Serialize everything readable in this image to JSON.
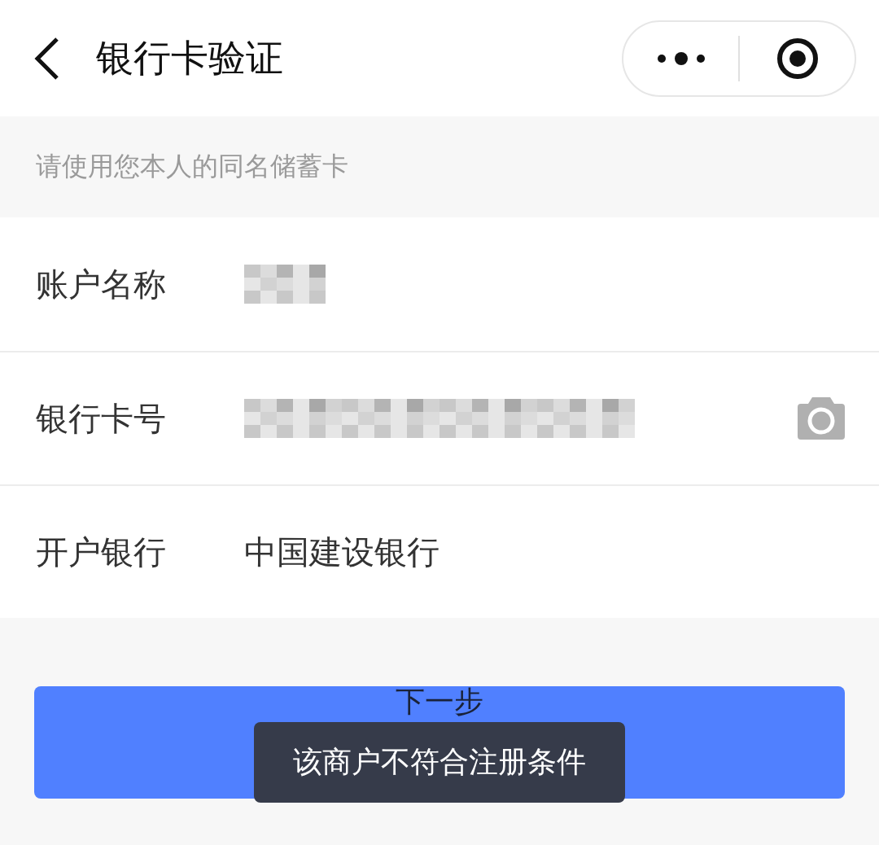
{
  "header": {
    "title": "银行卡验证"
  },
  "hint": "请使用您本人的同名储蓄卡",
  "fields": [
    {
      "kind": "masked",
      "label": "账户名称"
    },
    {
      "kind": "masked_camera",
      "label": "银行卡号"
    },
    {
      "kind": "text",
      "label": "开户银行",
      "value": "中国建设银行"
    }
  ],
  "button": {
    "label": "下一步"
  },
  "toast": "该商户不符合注册条件"
}
